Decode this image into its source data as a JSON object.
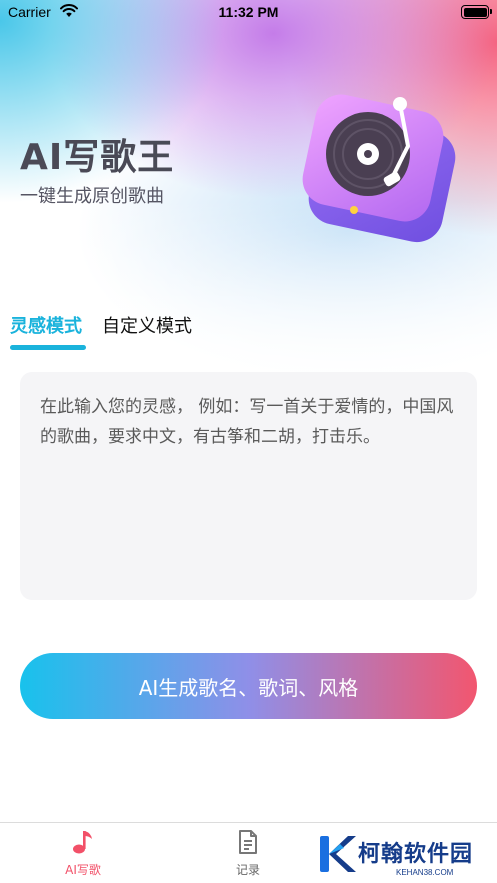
{
  "status_bar": {
    "carrier": "Carrier",
    "time": "11:32 PM"
  },
  "header": {
    "title": "AI写歌王",
    "subtitle": "一键生成原创歌曲"
  },
  "mode_tabs": [
    {
      "label": "灵感模式",
      "active": true
    },
    {
      "label": "自定义模式",
      "active": false
    }
  ],
  "prompt": {
    "value": "",
    "placeholder": "在此输入您的灵感， 例如：写一首关于爱情的，中国风的歌曲，要求中文，有古筝和二胡，打击乐。"
  },
  "generate_button": {
    "label": "AI生成歌名、歌词、风格"
  },
  "tabbar": {
    "items": [
      {
        "label": "AI写歌",
        "icon": "music-note-icon",
        "active": true
      },
      {
        "label": "记录",
        "icon": "document-icon",
        "active": false
      }
    ]
  },
  "watermark": {
    "text": "柯翰软件园",
    "url": "KEHAN38.COM"
  },
  "colors": {
    "accent_cyan": "#1ab3dc",
    "accent_pink": "#f25068",
    "button_start": "#18c2ec",
    "button_end": "#f2566f",
    "watermark_blue": "#153c8a"
  }
}
